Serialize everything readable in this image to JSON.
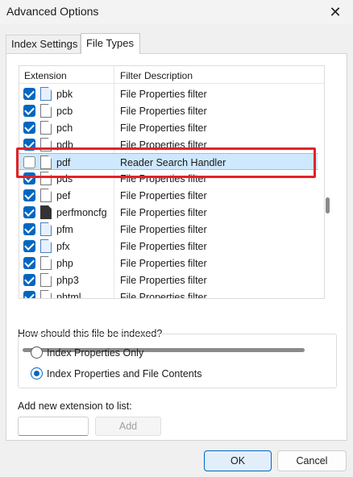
{
  "window": {
    "title": "Advanced Options",
    "close_glyph": "✕"
  },
  "tabs": [
    {
      "label": "Index Settings",
      "active": false
    },
    {
      "label": "File Types",
      "active": true
    }
  ],
  "list": {
    "columns": [
      "Extension",
      "Filter Description"
    ],
    "rows": [
      {
        "ext": "pbk",
        "desc": "File Properties filter",
        "checked": true,
        "icon": "network-file-icon"
      },
      {
        "ext": "pcb",
        "desc": "File Properties filter",
        "checked": true,
        "icon": "blank-file-icon"
      },
      {
        "ext": "pch",
        "desc": "File Properties filter",
        "checked": true,
        "icon": "blank-file-icon"
      },
      {
        "ext": "pdb",
        "desc": "File Properties filter",
        "checked": true,
        "icon": "blank-file-icon"
      },
      {
        "ext": "pdf",
        "desc": "Reader Search Handler",
        "checked": false,
        "icon": "blank-file-icon",
        "selected": true
      },
      {
        "ext": "pds",
        "desc": "File Properties filter",
        "checked": true,
        "icon": "blank-file-icon"
      },
      {
        "ext": "pef",
        "desc": "File Properties filter",
        "checked": true,
        "icon": "blank-file-icon"
      },
      {
        "ext": "perfmoncfg",
        "desc": "File Properties filter",
        "checked": true,
        "icon": "perfmon-file-icon"
      },
      {
        "ext": "pfm",
        "desc": "File Properties filter",
        "checked": true,
        "icon": "font-file-icon"
      },
      {
        "ext": "pfx",
        "desc": "File Properties filter",
        "checked": true,
        "icon": "certificate-file-icon"
      },
      {
        "ext": "php",
        "desc": "File Properties filter",
        "checked": true,
        "icon": "blank-file-icon"
      },
      {
        "ext": "php3",
        "desc": "File Properties filter",
        "checked": true,
        "icon": "blank-file-icon"
      },
      {
        "ext": "phtml",
        "desc": "File Properties filter",
        "checked": true,
        "icon": "blank-file-icon"
      }
    ]
  },
  "indexing": {
    "question": "How should this file be indexed?",
    "options": [
      {
        "label": "Index Properties Only",
        "selected": false
      },
      {
        "label": "Index Properties and File Contents",
        "selected": true
      }
    ]
  },
  "add_extension": {
    "label": "Add new extension to list:",
    "value": "",
    "button_label": "Add"
  },
  "footer": {
    "ok_label": "OK",
    "cancel_label": "Cancel"
  },
  "colors": {
    "accent": "#0067c0",
    "highlight_box": "#e0232a",
    "selection": "#cde8ff"
  }
}
